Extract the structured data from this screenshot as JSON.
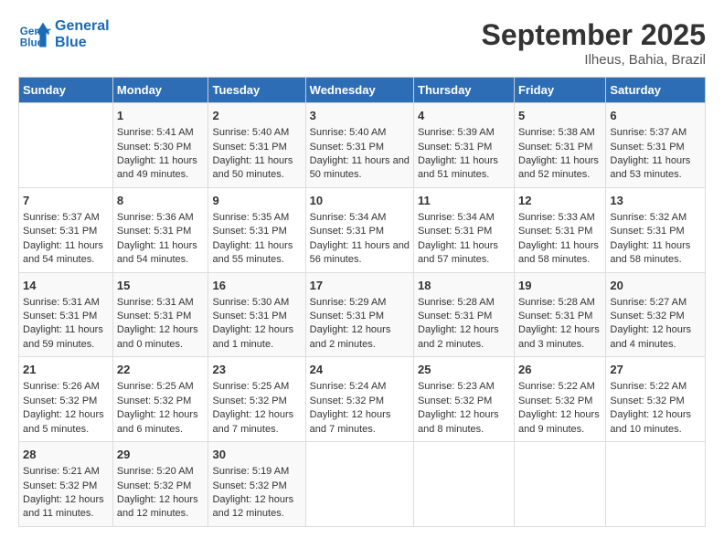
{
  "header": {
    "logo_line1": "General",
    "logo_line2": "Blue",
    "month": "September 2025",
    "location": "Ilheus, Bahia, Brazil"
  },
  "days_of_week": [
    "Sunday",
    "Monday",
    "Tuesday",
    "Wednesday",
    "Thursday",
    "Friday",
    "Saturday"
  ],
  "weeks": [
    [
      {
        "num": "",
        "sunrise": "",
        "sunset": "",
        "daylight": ""
      },
      {
        "num": "1",
        "sunrise": "Sunrise: 5:41 AM",
        "sunset": "Sunset: 5:30 PM",
        "daylight": "Daylight: 11 hours and 49 minutes."
      },
      {
        "num": "2",
        "sunrise": "Sunrise: 5:40 AM",
        "sunset": "Sunset: 5:31 PM",
        "daylight": "Daylight: 11 hours and 50 minutes."
      },
      {
        "num": "3",
        "sunrise": "Sunrise: 5:40 AM",
        "sunset": "Sunset: 5:31 PM",
        "daylight": "Daylight: 11 hours and 50 minutes."
      },
      {
        "num": "4",
        "sunrise": "Sunrise: 5:39 AM",
        "sunset": "Sunset: 5:31 PM",
        "daylight": "Daylight: 11 hours and 51 minutes."
      },
      {
        "num": "5",
        "sunrise": "Sunrise: 5:38 AM",
        "sunset": "Sunset: 5:31 PM",
        "daylight": "Daylight: 11 hours and 52 minutes."
      },
      {
        "num": "6",
        "sunrise": "Sunrise: 5:37 AM",
        "sunset": "Sunset: 5:31 PM",
        "daylight": "Daylight: 11 hours and 53 minutes."
      }
    ],
    [
      {
        "num": "7",
        "sunrise": "Sunrise: 5:37 AM",
        "sunset": "Sunset: 5:31 PM",
        "daylight": "Daylight: 11 hours and 54 minutes."
      },
      {
        "num": "8",
        "sunrise": "Sunrise: 5:36 AM",
        "sunset": "Sunset: 5:31 PM",
        "daylight": "Daylight: 11 hours and 54 minutes."
      },
      {
        "num": "9",
        "sunrise": "Sunrise: 5:35 AM",
        "sunset": "Sunset: 5:31 PM",
        "daylight": "Daylight: 11 hours and 55 minutes."
      },
      {
        "num": "10",
        "sunrise": "Sunrise: 5:34 AM",
        "sunset": "Sunset: 5:31 PM",
        "daylight": "Daylight: 11 hours and 56 minutes."
      },
      {
        "num": "11",
        "sunrise": "Sunrise: 5:34 AM",
        "sunset": "Sunset: 5:31 PM",
        "daylight": "Daylight: 11 hours and 57 minutes."
      },
      {
        "num": "12",
        "sunrise": "Sunrise: 5:33 AM",
        "sunset": "Sunset: 5:31 PM",
        "daylight": "Daylight: 11 hours and 58 minutes."
      },
      {
        "num": "13",
        "sunrise": "Sunrise: 5:32 AM",
        "sunset": "Sunset: 5:31 PM",
        "daylight": "Daylight: 11 hours and 58 minutes."
      }
    ],
    [
      {
        "num": "14",
        "sunrise": "Sunrise: 5:31 AM",
        "sunset": "Sunset: 5:31 PM",
        "daylight": "Daylight: 11 hours and 59 minutes."
      },
      {
        "num": "15",
        "sunrise": "Sunrise: 5:31 AM",
        "sunset": "Sunset: 5:31 PM",
        "daylight": "Daylight: 12 hours and 0 minutes."
      },
      {
        "num": "16",
        "sunrise": "Sunrise: 5:30 AM",
        "sunset": "Sunset: 5:31 PM",
        "daylight": "Daylight: 12 hours and 1 minute."
      },
      {
        "num": "17",
        "sunrise": "Sunrise: 5:29 AM",
        "sunset": "Sunset: 5:31 PM",
        "daylight": "Daylight: 12 hours and 2 minutes."
      },
      {
        "num": "18",
        "sunrise": "Sunrise: 5:28 AM",
        "sunset": "Sunset: 5:31 PM",
        "daylight": "Daylight: 12 hours and 2 minutes."
      },
      {
        "num": "19",
        "sunrise": "Sunrise: 5:28 AM",
        "sunset": "Sunset: 5:31 PM",
        "daylight": "Daylight: 12 hours and 3 minutes."
      },
      {
        "num": "20",
        "sunrise": "Sunrise: 5:27 AM",
        "sunset": "Sunset: 5:32 PM",
        "daylight": "Daylight: 12 hours and 4 minutes."
      }
    ],
    [
      {
        "num": "21",
        "sunrise": "Sunrise: 5:26 AM",
        "sunset": "Sunset: 5:32 PM",
        "daylight": "Daylight: 12 hours and 5 minutes."
      },
      {
        "num": "22",
        "sunrise": "Sunrise: 5:25 AM",
        "sunset": "Sunset: 5:32 PM",
        "daylight": "Daylight: 12 hours and 6 minutes."
      },
      {
        "num": "23",
        "sunrise": "Sunrise: 5:25 AM",
        "sunset": "Sunset: 5:32 PM",
        "daylight": "Daylight: 12 hours and 7 minutes."
      },
      {
        "num": "24",
        "sunrise": "Sunrise: 5:24 AM",
        "sunset": "Sunset: 5:32 PM",
        "daylight": "Daylight: 12 hours and 7 minutes."
      },
      {
        "num": "25",
        "sunrise": "Sunrise: 5:23 AM",
        "sunset": "Sunset: 5:32 PM",
        "daylight": "Daylight: 12 hours and 8 minutes."
      },
      {
        "num": "26",
        "sunrise": "Sunrise: 5:22 AM",
        "sunset": "Sunset: 5:32 PM",
        "daylight": "Daylight: 12 hours and 9 minutes."
      },
      {
        "num": "27",
        "sunrise": "Sunrise: 5:22 AM",
        "sunset": "Sunset: 5:32 PM",
        "daylight": "Daylight: 12 hours and 10 minutes."
      }
    ],
    [
      {
        "num": "28",
        "sunrise": "Sunrise: 5:21 AM",
        "sunset": "Sunset: 5:32 PM",
        "daylight": "Daylight: 12 hours and 11 minutes."
      },
      {
        "num": "29",
        "sunrise": "Sunrise: 5:20 AM",
        "sunset": "Sunset: 5:32 PM",
        "daylight": "Daylight: 12 hours and 12 minutes."
      },
      {
        "num": "30",
        "sunrise": "Sunrise: 5:19 AM",
        "sunset": "Sunset: 5:32 PM",
        "daylight": "Daylight: 12 hours and 12 minutes."
      },
      {
        "num": "",
        "sunrise": "",
        "sunset": "",
        "daylight": ""
      },
      {
        "num": "",
        "sunrise": "",
        "sunset": "",
        "daylight": ""
      },
      {
        "num": "",
        "sunrise": "",
        "sunset": "",
        "daylight": ""
      },
      {
        "num": "",
        "sunrise": "",
        "sunset": "",
        "daylight": ""
      }
    ]
  ]
}
